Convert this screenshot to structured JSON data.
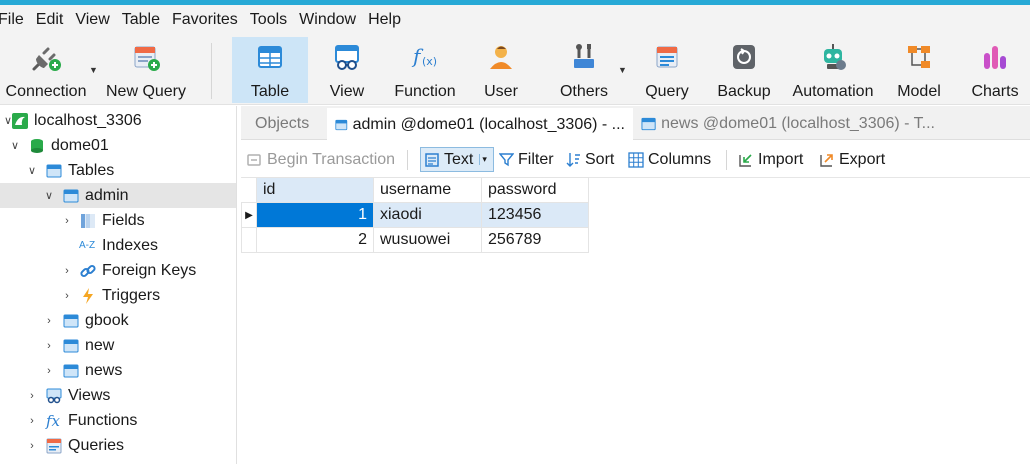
{
  "menu": {
    "items": [
      {
        "label": "File"
      },
      {
        "label": "Edit"
      },
      {
        "label": "View"
      },
      {
        "label": "Table"
      },
      {
        "label": "Favorites"
      },
      {
        "label": "Tools"
      },
      {
        "label": "Window"
      },
      {
        "label": "Help"
      }
    ]
  },
  "toolbar": {
    "connection": "Connection",
    "new_query": "New Query",
    "table": "Table",
    "view": "View",
    "function": "Function",
    "user": "User",
    "others": "Others",
    "query": "Query",
    "backup": "Backup",
    "automation": "Automation",
    "model": "Model",
    "charts": "Charts"
  },
  "sidebar": {
    "connection": "localhost_3306",
    "database": "dome01",
    "tables_group": "Tables",
    "selected_table": "admin",
    "fields": "Fields",
    "indexes": "Indexes",
    "foreign_keys": "Foreign Keys",
    "triggers": "Triggers",
    "table_gbook": "gbook",
    "table_new": "new",
    "table_news": "news",
    "views": "Views",
    "functions": "Functions",
    "queries": "Queries"
  },
  "tabs": {
    "objects": "Objects",
    "admin_tab": "admin @dome01 (localhost_3306) - ...",
    "news_tab": "news @dome01 (localhost_3306) - T..."
  },
  "subtoolbar": {
    "begin_transaction": "Begin Transaction",
    "text": "Text",
    "filter": "Filter",
    "sort": "Sort",
    "columns": "Columns",
    "import": "Import",
    "export": "Export"
  },
  "grid": {
    "columns": [
      "id",
      "username",
      "password"
    ],
    "rows": [
      {
        "id": "1",
        "username": "xiaodi",
        "password": "123456"
      },
      {
        "id": "2",
        "username": "wusuowei",
        "password": "256789"
      }
    ]
  },
  "colors": {
    "accent": "#27a9d6",
    "selection": "#0078d7",
    "selected_row": "#dbe9f7",
    "active_tool": "#cde5f7"
  }
}
